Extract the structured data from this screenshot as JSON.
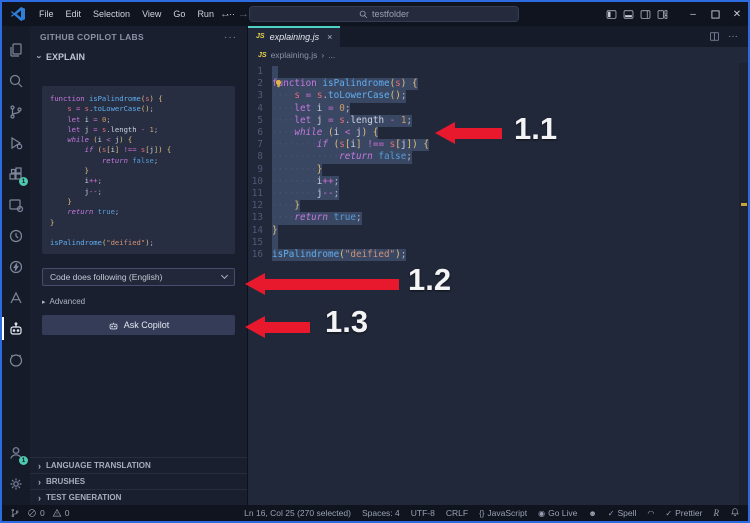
{
  "title_bar": {
    "menus": [
      "File",
      "Edit",
      "Selection",
      "View",
      "Go",
      "Run",
      "···"
    ],
    "back_arrow": "←",
    "forward_arrow": "→",
    "search_value": "testfolder"
  },
  "activity_bar": {
    "icons": [
      "explorer",
      "search",
      "source-control",
      "run-debug",
      "extensions",
      "remote",
      "test-clock",
      "thunder",
      "azure",
      "copilot-labs",
      "github",
      "accounts",
      "settings"
    ],
    "active_icon": "copilot-labs",
    "extensions_badge": "1",
    "accounts_badge": "1",
    "badge_color": "#4ec9b0"
  },
  "sidebar": {
    "title": "GITHUB COPILOT LABS",
    "more_actions": "···",
    "explain_section": "EXPLAIN",
    "dropdown_value": "Code does following (English)",
    "advanced_label": "Advanced",
    "advanced_marker": "▸",
    "ask_copilot_label": "Ask Copilot",
    "collapsed_sections": [
      "LANGUAGE TRANSLATION",
      "BRUSHES",
      "TEST GENERATION"
    ],
    "collapse_chevron": "›"
  },
  "editor": {
    "tab_file_icon": "JS",
    "tab_label": "explaining.js",
    "tab_close": "×",
    "tab_more": "···",
    "breadcrumb_file_icon": "JS",
    "breadcrumb_file": "explaining.js",
    "breadcrumb_sep": "›",
    "breadcrumb_more": "..."
  },
  "code": {
    "lines": [
      [],
      [
        [
          "function",
          "kw"
        ],
        [
          " ",
          "pl"
        ],
        [
          "isPalindrome",
          "fn"
        ],
        [
          "(",
          "br"
        ],
        [
          "s",
          "pr"
        ],
        [
          ")",
          "br"
        ],
        [
          " ",
          "pl"
        ],
        [
          "{",
          "br"
        ]
      ],
      [
        [
          "    ",
          "ws"
        ],
        [
          "s",
          "pr"
        ],
        [
          " ",
          "pl"
        ],
        [
          "=",
          "op"
        ],
        [
          " ",
          "pl"
        ],
        [
          "s",
          "pr"
        ],
        [
          ".",
          "pl"
        ],
        [
          "toLowerCase",
          "fn"
        ],
        [
          "()",
          "br"
        ],
        [
          ";",
          "pl"
        ]
      ],
      [
        [
          "    ",
          "ws"
        ],
        [
          "let",
          "kw"
        ],
        [
          " ",
          "pl"
        ],
        [
          "i",
          "vr"
        ],
        [
          " ",
          "pl"
        ],
        [
          "=",
          "op"
        ],
        [
          " ",
          "pl"
        ],
        [
          "0",
          "num"
        ],
        [
          ";",
          "pl"
        ]
      ],
      [
        [
          "    ",
          "ws"
        ],
        [
          "let",
          "kw"
        ],
        [
          " ",
          "pl"
        ],
        [
          "j",
          "vr"
        ],
        [
          " ",
          "pl"
        ],
        [
          "=",
          "op"
        ],
        [
          " ",
          "pl"
        ],
        [
          "s",
          "pr"
        ],
        [
          ".",
          "pl"
        ],
        [
          "length",
          "vr"
        ],
        [
          " ",
          "pl"
        ],
        [
          "-",
          "op"
        ],
        [
          " ",
          "pl"
        ],
        [
          "1",
          "num"
        ],
        [
          ";",
          "pl"
        ]
      ],
      [
        [
          "    ",
          "ws"
        ],
        [
          "while",
          "kwi"
        ],
        [
          " ",
          "pl"
        ],
        [
          "(",
          "br"
        ],
        [
          "i",
          "vr"
        ],
        [
          " ",
          "pl"
        ],
        [
          "<",
          "op"
        ],
        [
          " ",
          "pl"
        ],
        [
          "j",
          "vr"
        ],
        [
          ")",
          "br"
        ],
        [
          " ",
          "pl"
        ],
        [
          "{",
          "br"
        ]
      ],
      [
        [
          "        ",
          "ws"
        ],
        [
          "if",
          "kwi"
        ],
        [
          " ",
          "pl"
        ],
        [
          "(",
          "br"
        ],
        [
          "s",
          "pr"
        ],
        [
          "[",
          "br"
        ],
        [
          "i",
          "vr"
        ],
        [
          "]",
          "br"
        ],
        [
          " ",
          "pl"
        ],
        [
          "!==",
          "op"
        ],
        [
          " ",
          "pl"
        ],
        [
          "s",
          "pr"
        ],
        [
          "[",
          "br"
        ],
        [
          "j",
          "vr"
        ],
        [
          "]",
          "br"
        ],
        [
          ")",
          "br"
        ],
        [
          " ",
          "pl"
        ],
        [
          "{",
          "br"
        ]
      ],
      [
        [
          "            ",
          "ws"
        ],
        [
          "return",
          "kwi"
        ],
        [
          " ",
          "pl"
        ],
        [
          "false",
          "bool"
        ],
        [
          ";",
          "pl"
        ]
      ],
      [
        [
          "        ",
          "ws"
        ],
        [
          "}",
          "br"
        ]
      ],
      [
        [
          "        ",
          "ws"
        ],
        [
          "i",
          "vr"
        ],
        [
          "++",
          "op"
        ],
        [
          ";",
          "pl"
        ]
      ],
      [
        [
          "        ",
          "ws"
        ],
        [
          "j",
          "vr"
        ],
        [
          "--",
          "op"
        ],
        [
          ";",
          "pl"
        ]
      ],
      [
        [
          "    ",
          "ws"
        ],
        [
          "}",
          "br"
        ]
      ],
      [
        [
          "    ",
          "ws"
        ],
        [
          "return",
          "kwi"
        ],
        [
          " ",
          "pl"
        ],
        [
          "true",
          "bool"
        ],
        [
          ";",
          "pl"
        ]
      ],
      [
        [
          "}",
          "br"
        ]
      ],
      [],
      [
        [
          "isPalindrome",
          "fn"
        ],
        [
          "(",
          "br"
        ],
        [
          "\"deified\"",
          "str"
        ],
        [
          ")",
          "br"
        ],
        [
          ";",
          "pl"
        ]
      ]
    ]
  },
  "annotations": {
    "labels": [
      "1.1",
      "1.2",
      "1.3"
    ],
    "arrow_color": "#e8192c"
  },
  "status_bar": {
    "errors": "0",
    "warnings": "0",
    "right_items": [
      {
        "icon": "",
        "label": "Ln 16, Col 25 (270 selected)"
      },
      {
        "icon": "",
        "label": "Spaces: 4"
      },
      {
        "icon": "",
        "label": "UTF-8"
      },
      {
        "icon": "",
        "label": "CRLF"
      },
      {
        "icon": "braces",
        "label": "JavaScript"
      },
      {
        "icon": "golive",
        "label": "Go Live"
      },
      {
        "icon": "github",
        "label": ""
      },
      {
        "icon": "check",
        "label": "Spell"
      },
      {
        "icon": "arc",
        "label": ""
      },
      {
        "icon": "check",
        "label": "Prettier"
      },
      {
        "icon": "r",
        "label": ""
      }
    ]
  }
}
